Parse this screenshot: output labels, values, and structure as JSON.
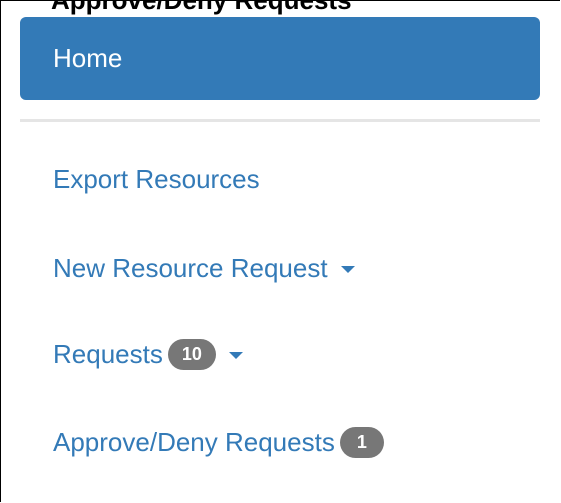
{
  "top_partial_text": "Approve/Deny Requests",
  "nav": {
    "home": {
      "label": "Home",
      "active": true
    },
    "export": {
      "label": "Export Resources"
    },
    "new_request": {
      "label": "New Resource Request",
      "has_dropdown": true
    },
    "requests": {
      "label": "Requests",
      "badge": "10",
      "has_dropdown": true
    },
    "approve": {
      "label": "Approve/Deny Requests",
      "badge": "1"
    }
  },
  "colors": {
    "active_bg": "#337ab7",
    "link": "#337ab7",
    "badge_bg": "#777777",
    "divider": "#e5e5e5"
  },
  "icons": {
    "dropdown": "caret-down-icon"
  }
}
